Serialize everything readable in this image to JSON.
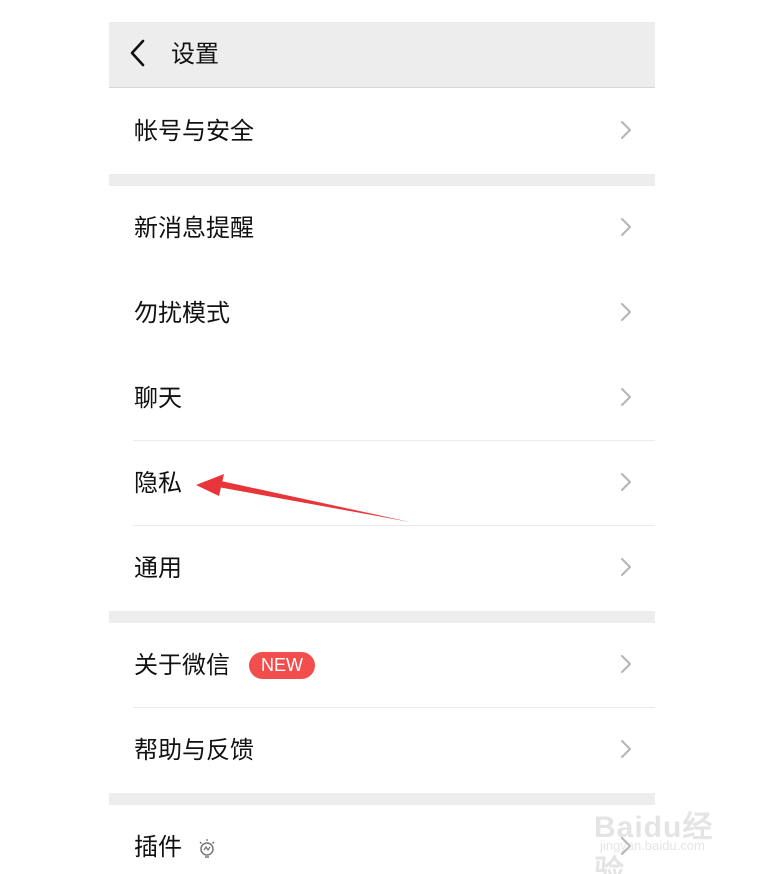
{
  "header": {
    "title": "设置"
  },
  "groups": [
    {
      "items": [
        {
          "label": "帐号与安全"
        }
      ]
    },
    {
      "items": [
        {
          "label": "新消息提醒"
        },
        {
          "label": "勿扰模式"
        },
        {
          "label": "聊天"
        },
        {
          "label": "隐私"
        },
        {
          "label": "通用"
        }
      ]
    },
    {
      "items": [
        {
          "label": "关于微信",
          "badge": "NEW"
        },
        {
          "label": "帮助与反馈"
        }
      ]
    },
    {
      "items": [
        {
          "label": "插件",
          "icon": "lightbulb-icon"
        }
      ]
    }
  ],
  "watermark": {
    "brand": "Baidu经验",
    "url": "jingyan.baidu.com"
  },
  "colors": {
    "badge": "#f24e4e",
    "annotation_arrow": "#e8353a",
    "header_bg": "#ededed",
    "separator_bg": "#ededed"
  }
}
